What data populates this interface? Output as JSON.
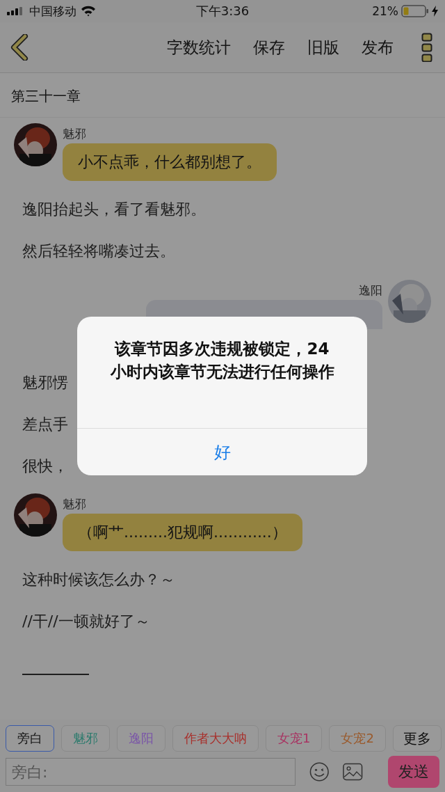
{
  "status_bar": {
    "carrier": "中国移动",
    "time": "下午3:36",
    "battery": "21%"
  },
  "nav": {
    "actions": [
      "字数统计",
      "保存",
      "旧版",
      "发布"
    ]
  },
  "chapter": {
    "title": "第三十一章"
  },
  "content": [
    {
      "kind": "left_message",
      "speaker": "魅邪",
      "text": "小不点乖，什么都别想了。"
    },
    {
      "kind": "narration",
      "text": "逸阳抬起头，看了看魅邪。"
    },
    {
      "kind": "narration",
      "text": "然后轻轻将嘴凑过去。"
    },
    {
      "kind": "right_message",
      "speaker": "逸阳"
    },
    {
      "kind": "narration",
      "text": "魅邪愣"
    },
    {
      "kind": "narration",
      "text": "差点手"
    },
    {
      "kind": "narration",
      "text": "很快，"
    },
    {
      "kind": "left_message",
      "speaker": "魅邪",
      "text": "（啊艹.........犯规啊............）"
    },
    {
      "kind": "narration",
      "text": "这种时候该怎么办？～"
    },
    {
      "kind": "narration",
      "text": "//干//一顿就好了～"
    },
    {
      "kind": "rule"
    }
  ],
  "roles": [
    {
      "label": "旁白",
      "color": "#141414",
      "selected": true
    },
    {
      "label": "魅邪",
      "color": "#2a7a6c",
      "selected": false
    },
    {
      "label": "逸阳",
      "color": "#7a55a8",
      "selected": false
    },
    {
      "label": "作者大大呐",
      "color": "#a8302c",
      "selected": false
    },
    {
      "label": "女宠1",
      "color": "#a83462",
      "selected": false
    },
    {
      "label": "女宠2",
      "color": "#9a5a2c",
      "selected": false
    }
  ],
  "more_button": "更多",
  "composer": {
    "placeholder": "旁白:",
    "send": "发送"
  },
  "alert": {
    "message": "该章节因多次违规被锁定，24小时内该章节无法进行任何操作",
    "button": "好"
  }
}
